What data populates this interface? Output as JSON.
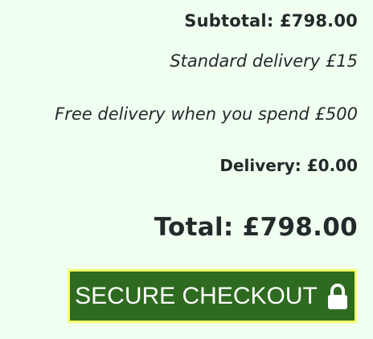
{
  "summary": {
    "subtotal": "Subtotal: £798.00",
    "standard_delivery": "Standard delivery £15",
    "free_delivery_note": "Free delivery when you spend £500",
    "delivery": "Delivery: £0.00",
    "total": "Total: £798.00"
  },
  "checkout": {
    "label": "SECURE CHECKOUT",
    "icon": "lock-icon"
  },
  "colors": {
    "background": "#f0fff0",
    "button_bg": "#2e6a1f",
    "button_border": "#f4ff66",
    "text": "#222a2a"
  }
}
